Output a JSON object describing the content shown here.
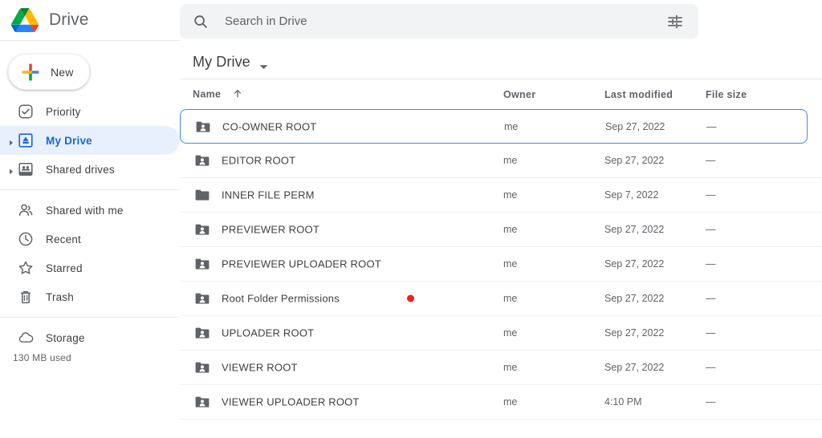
{
  "brand": {
    "name": "Drive",
    "logo_icon": "drive-logo-icon",
    "colors": {
      "green": "#0f9d58",
      "yellow": "#ffc107",
      "blue": "#4285f4",
      "red": "#ea4335"
    }
  },
  "new_button": {
    "label": "New",
    "icon": "plus-icon"
  },
  "search": {
    "placeholder": "Search in Drive",
    "value": "",
    "search_icon": "search-icon",
    "filter_icon": "tune-filter-icon"
  },
  "sidebar": {
    "items": [
      {
        "label": "Priority",
        "icon": "priority-check-icon",
        "expandable": false,
        "active": false
      },
      {
        "label": "My Drive",
        "icon": "my-drive-icon",
        "expandable": true,
        "active": true
      },
      {
        "label": "Shared drives",
        "icon": "shared-drives-icon",
        "expandable": true,
        "active": false
      },
      {
        "label": "Shared with me",
        "icon": "people-icon",
        "expandable": false,
        "active": false
      },
      {
        "label": "Recent",
        "icon": "clock-icon",
        "expandable": false,
        "active": false
      },
      {
        "label": "Starred",
        "icon": "star-icon",
        "expandable": false,
        "active": false
      },
      {
        "label": "Trash",
        "icon": "trash-icon",
        "expandable": false,
        "active": false
      },
      {
        "label": "Storage",
        "icon": "cloud-icon",
        "expandable": false,
        "active": false
      }
    ],
    "storage_used": "130 MB used",
    "active_color": "#1967d2",
    "active_bg": "#e8f0fe"
  },
  "breadcrumb": {
    "title": "My Drive",
    "caret_icon": "chevron-down-icon"
  },
  "table": {
    "columns": {
      "name": "Name",
      "owner": "Owner",
      "modified": "Last modified",
      "size": "File size"
    },
    "sort": {
      "column": "Name",
      "direction": "asc",
      "icon": "arrow-up-icon"
    },
    "rows": [
      {
        "name": "CO-OWNER ROOT",
        "icon": "shared-folder-icon",
        "owner": "me",
        "modified": "Sep 27, 2022",
        "size": "—",
        "selected": true,
        "marker": false
      },
      {
        "name": "EDITOR ROOT",
        "icon": "shared-folder-icon",
        "owner": "me",
        "modified": "Sep 27, 2022",
        "size": "—",
        "selected": false,
        "marker": false
      },
      {
        "name": "INNER FILE PERM",
        "icon": "folder-icon",
        "owner": "me",
        "modified": "Sep 7, 2022",
        "size": "—",
        "selected": false,
        "marker": false
      },
      {
        "name": "PREVIEWER ROOT",
        "icon": "shared-folder-icon",
        "owner": "me",
        "modified": "Sep 27, 2022",
        "size": "—",
        "selected": false,
        "marker": false
      },
      {
        "name": "PREVIEWER UPLOADER ROOT",
        "icon": "shared-folder-icon",
        "owner": "me",
        "modified": "Sep 27, 2022",
        "size": "—",
        "selected": false,
        "marker": false
      },
      {
        "name": "Root Folder Permissions",
        "icon": "shared-folder-icon",
        "owner": "me",
        "modified": "Sep 27, 2022",
        "size": "—",
        "selected": false,
        "marker": true
      },
      {
        "name": "UPLOADER ROOT",
        "icon": "shared-folder-icon",
        "owner": "me",
        "modified": "Sep 27, 2022",
        "size": "—",
        "selected": false,
        "marker": false
      },
      {
        "name": "VIEWER ROOT",
        "icon": "shared-folder-icon",
        "owner": "me",
        "modified": "Sep 27, 2022",
        "size": "—",
        "selected": false,
        "marker": false
      },
      {
        "name": "VIEWER UPLOADER ROOT",
        "icon": "shared-folder-icon",
        "owner": "me",
        "modified": "4:10 PM",
        "size": "—",
        "selected": false,
        "marker": false
      }
    ]
  },
  "marker": {
    "color": "#e8241c",
    "name": "cursor-dot-marker"
  }
}
